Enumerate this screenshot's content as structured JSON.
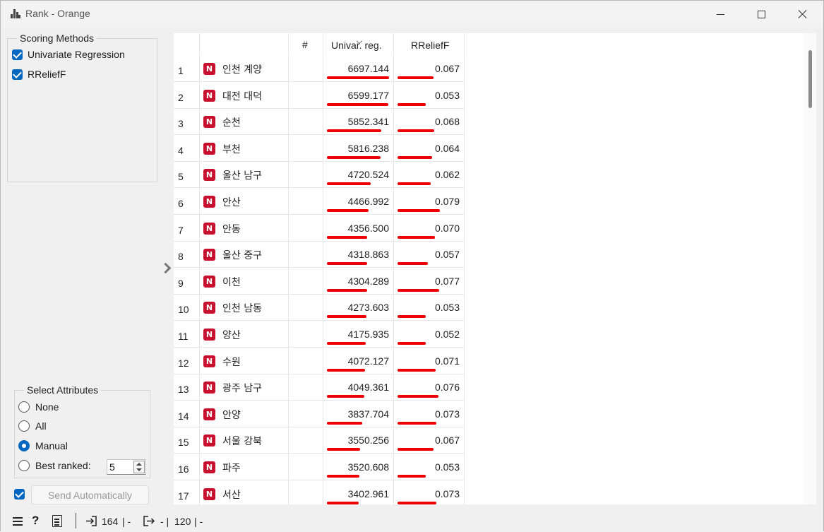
{
  "window": {
    "title": "Rank - Orange"
  },
  "scoring": {
    "title": "Scoring Methods",
    "methods": [
      {
        "label": "Univariate Regression",
        "checked": true
      },
      {
        "label": "RReliefF",
        "checked": true
      }
    ]
  },
  "select_attributes": {
    "title": "Select Attributes",
    "options": [
      {
        "label": "None",
        "selected": false
      },
      {
        "label": "All",
        "selected": false
      },
      {
        "label": "Manual",
        "selected": true
      },
      {
        "label": "Best ranked:",
        "selected": false
      }
    ],
    "best_ranked_value": "5"
  },
  "send": {
    "label": "Send Automatically",
    "auto_checked": true
  },
  "table": {
    "columns": [
      "",
      "#",
      "Univar. reg.",
      "RReliefF"
    ],
    "sort_column": "Univar. reg.",
    "badge": "N",
    "rows": [
      {
        "num": "1",
        "name": "인천 계양",
        "univar": "6697.144",
        "relief": "0.067"
      },
      {
        "num": "2",
        "name": "대전 대덕",
        "univar": "6599.177",
        "relief": "0.053"
      },
      {
        "num": "3",
        "name": "순천",
        "univar": "5852.341",
        "relief": "0.068"
      },
      {
        "num": "4",
        "name": "부천",
        "univar": "5816.238",
        "relief": "0.064"
      },
      {
        "num": "5",
        "name": "울산 남구",
        "univar": "4720.524",
        "relief": "0.062"
      },
      {
        "num": "6",
        "name": "안산",
        "univar": "4466.992",
        "relief": "0.079"
      },
      {
        "num": "7",
        "name": "안동",
        "univar": "4356.500",
        "relief": "0.070"
      },
      {
        "num": "8",
        "name": "울산 중구",
        "univar": "4318.863",
        "relief": "0.057"
      },
      {
        "num": "9",
        "name": "이천",
        "univar": "4304.289",
        "relief": "0.077"
      },
      {
        "num": "10",
        "name": "인천 남동",
        "univar": "4273.603",
        "relief": "0.053"
      },
      {
        "num": "11",
        "name": "양산",
        "univar": "4175.935",
        "relief": "0.052"
      },
      {
        "num": "12",
        "name": "수원",
        "univar": "4072.127",
        "relief": "0.071"
      },
      {
        "num": "13",
        "name": "광주 남구",
        "univar": "4049.361",
        "relief": "0.076"
      },
      {
        "num": "14",
        "name": "안양",
        "univar": "3837.704",
        "relief": "0.073"
      },
      {
        "num": "15",
        "name": "서울 강북",
        "univar": "3550.256",
        "relief": "0.067"
      },
      {
        "num": "16",
        "name": "파주",
        "univar": "3520.608",
        "relief": "0.053"
      },
      {
        "num": "17",
        "name": "서산",
        "univar": "3402.961",
        "relief": "0.073"
      }
    ]
  },
  "status": {
    "input_count": "164",
    "input_suffix": "| -",
    "output_prefix": "- |",
    "output_count": "120",
    "output_suffix": "| -"
  },
  "colors": {
    "accent": "#0067c0",
    "badge": "#c8102e",
    "bar": "#ee0000"
  }
}
